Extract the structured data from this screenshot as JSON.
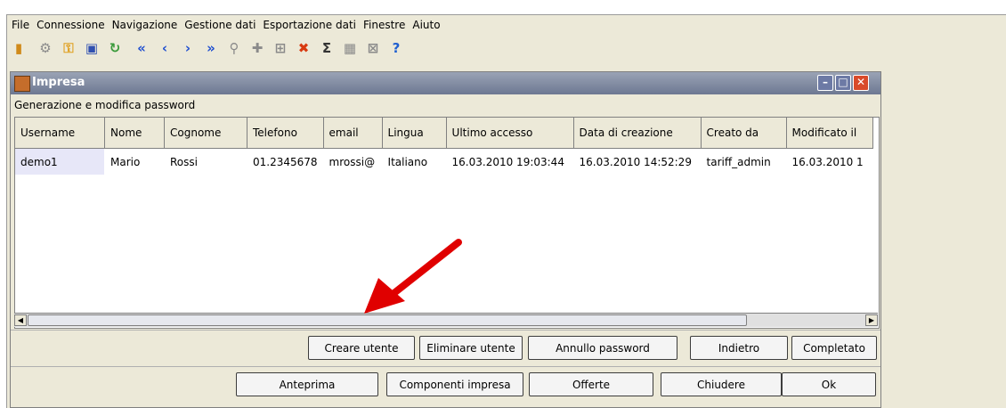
{
  "menu": [
    "File",
    "Connessione",
    "Navigazione",
    "Gestione dati",
    "Esportazione dati",
    "Finestre",
    "Aiuto"
  ],
  "toolbar_icons": [
    "exit-icon",
    "connect-icon",
    "key-icon",
    "save-icon",
    "refresh-icon",
    "first-icon",
    "prev-icon",
    "next-icon",
    "last-icon",
    "search-icon",
    "add-icon",
    "tree-icon",
    "delete-icon",
    "sum-icon",
    "calendar-icon",
    "close-icon",
    "help-icon"
  ],
  "window": {
    "title": "Impresa",
    "subtitle": "Generazione e modifica password"
  },
  "table": {
    "columns": [
      "Username",
      "Nome",
      "Cognome",
      "Telefono",
      "email",
      "Lingua",
      "Ultimo accesso",
      "Data di creazione",
      "Creato da",
      "Modificato il"
    ],
    "rows": [
      [
        "demo1",
        "Mario",
        "Rossi",
        "01.2345678",
        "mrossi@",
        "Italiano",
        "16.03.2010 19:03:44",
        "16.03.2010 14:52:29",
        "tariff_admin",
        "16.03.2010 1"
      ]
    ]
  },
  "buttons_row1": [
    "Creare utente",
    "Eliminare utente",
    "Annullo password",
    "Indietro",
    "Completato"
  ],
  "buttons_row2": [
    "Anteprima",
    "Componenti impresa",
    "Offerte",
    "Chiudere",
    "Ok"
  ],
  "colors": {
    "arrow": "#e00000",
    "titlebar": "#7b86a1",
    "close": "#d94a2a"
  }
}
